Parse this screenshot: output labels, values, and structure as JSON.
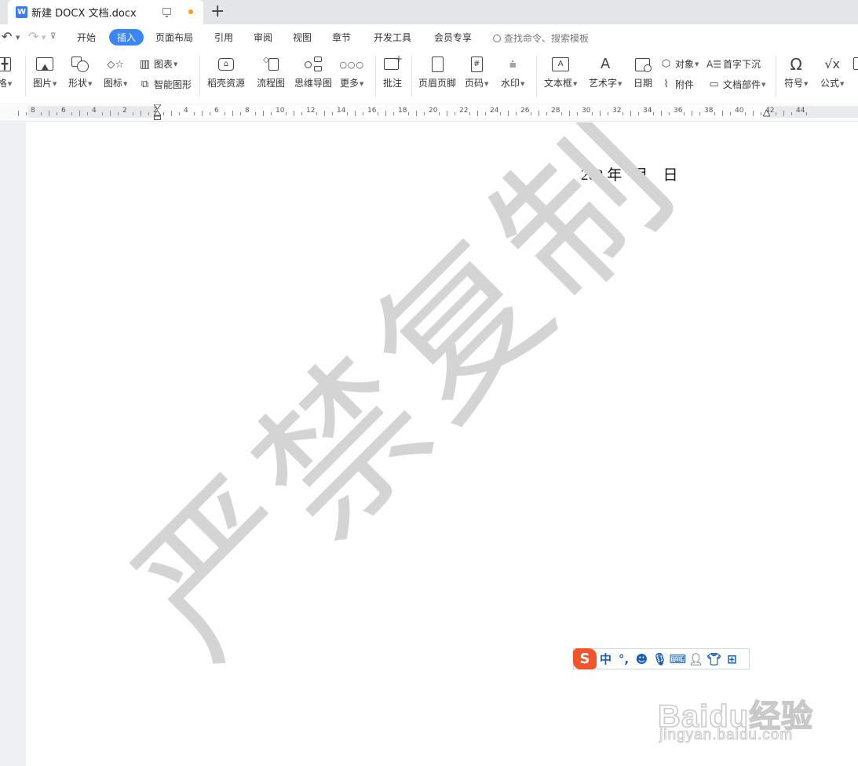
{
  "tab": {
    "title": "新建 DOCX 文档.docx",
    "app_icon": "W",
    "new_tab": "+"
  },
  "menu": {
    "items": [
      "开始",
      "插入",
      "页面布局",
      "引用",
      "审阅",
      "视图",
      "章节",
      "开发工具",
      "会员专享"
    ],
    "active": "插入",
    "search_label": "查找命令、搜索模板"
  },
  "ribbon": {
    "table": "格",
    "picture": "图片",
    "shape": "形状",
    "icon": "图标",
    "chart": "图表",
    "smart_art": "智能图形",
    "daoke": "稻壳资源",
    "flowchart": "流程图",
    "mindmap": "思维导图",
    "more": "更多",
    "comment": "批注",
    "header_footer": "页眉页脚",
    "page_number": "页码",
    "watermark": "水印",
    "textbox": "文本框",
    "wordart": "艺术字",
    "date": "日期",
    "object": "对象",
    "attachment": "附件",
    "drop_cap": "首字下沉",
    "doc_parts": "文档部件",
    "symbol": "符号",
    "formula": "公式"
  },
  "ruler": {
    "labels": [
      "8",
      "6",
      "4",
      "2",
      "2",
      "4",
      "6",
      "8",
      "10",
      "12",
      "14",
      "16",
      "18",
      "20",
      "22",
      "24",
      "26",
      "28",
      "30",
      "32",
      "34",
      "36",
      "38",
      "40",
      "42",
      "44"
    ]
  },
  "document": {
    "date_text": "202 年   月    日",
    "watermark_text": "严禁复制"
  },
  "ime": {
    "logo": "S",
    "lang": "中",
    "punct": "°,"
  },
  "baidu": {
    "brand": "Baidu经验",
    "url": "jingyan.baidu.com"
  },
  "colors": {
    "accent": "#3c85f5",
    "tab_bar": "#e3e5e8",
    "watermark": "#d4d4d4",
    "ime_blue": "#1a5fb4",
    "ime_logo": "#f2552c"
  }
}
